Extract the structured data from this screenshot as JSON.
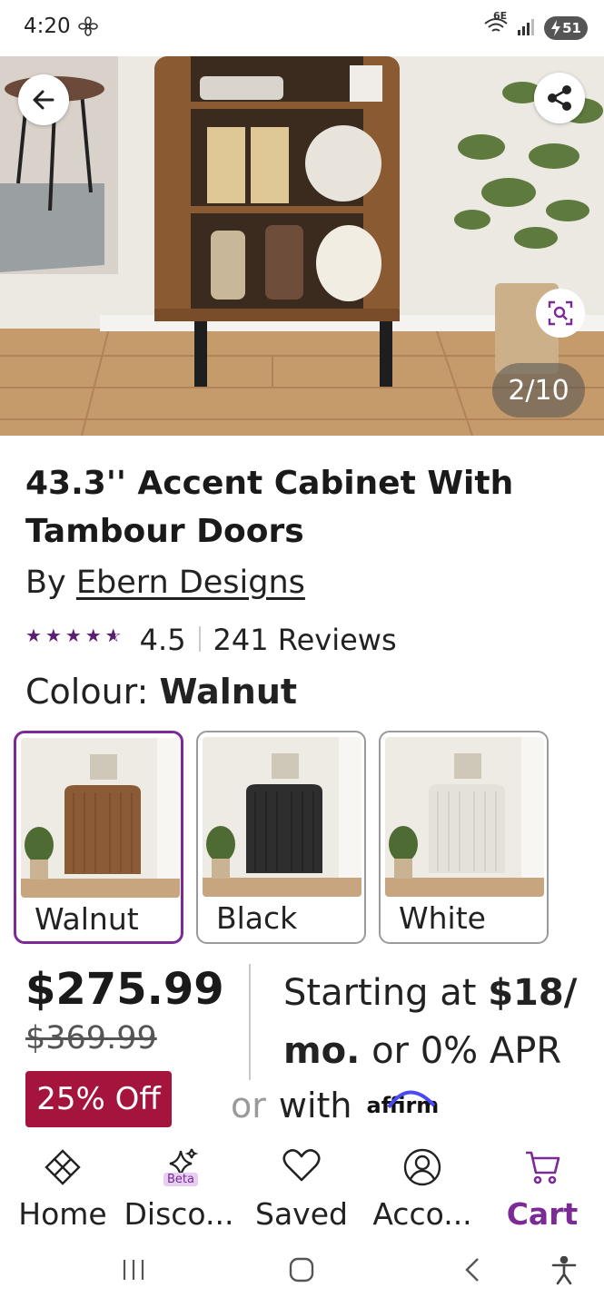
{
  "status_bar": {
    "time": "4:20",
    "network": "6E",
    "battery": "51"
  },
  "gallery": {
    "counter": "2/10"
  },
  "product": {
    "title": "43.3'' Accent Cabinet With Tambour Doors",
    "by_label": "By",
    "brand": "Ebern Designs",
    "rating_stars": 4.5,
    "rating_value": "4.5",
    "reviews": "241 Reviews",
    "colour_label": "Colour:",
    "colour_value": "Walnut"
  },
  "swatches": [
    {
      "label": "Walnut",
      "selected": true,
      "color": "#8b5a36"
    },
    {
      "label": "Black",
      "selected": false,
      "color": "#2e2e2e"
    },
    {
      "label": "White",
      "selected": false,
      "color": "#e4e1da"
    }
  ],
  "pricing": {
    "price": "$275.99",
    "was_price": "$369.99",
    "discount": "25% Off",
    "financing_prefix": "Starting at",
    "financing_amount": "$18/",
    "financing_mo": "mo.",
    "financing_suffix": "or 0% APR",
    "or_label": "or",
    "with_label": "with",
    "affirm": "affirm"
  },
  "bottom_nav": [
    {
      "label": "Home",
      "icon": "home-icon",
      "active": false
    },
    {
      "label": "Disco...",
      "icon": "discover-sparkle-icon",
      "active": false,
      "badge": "Beta"
    },
    {
      "label": "Saved",
      "icon": "heart-icon",
      "active": false
    },
    {
      "label": "Acco...",
      "icon": "account-icon",
      "active": false
    },
    {
      "label": "Cart",
      "icon": "cart-icon",
      "active": true
    }
  ],
  "colors": {
    "accent": "#7b2a96",
    "discount_bg": "#a5143d",
    "star": "#5b1e73"
  }
}
